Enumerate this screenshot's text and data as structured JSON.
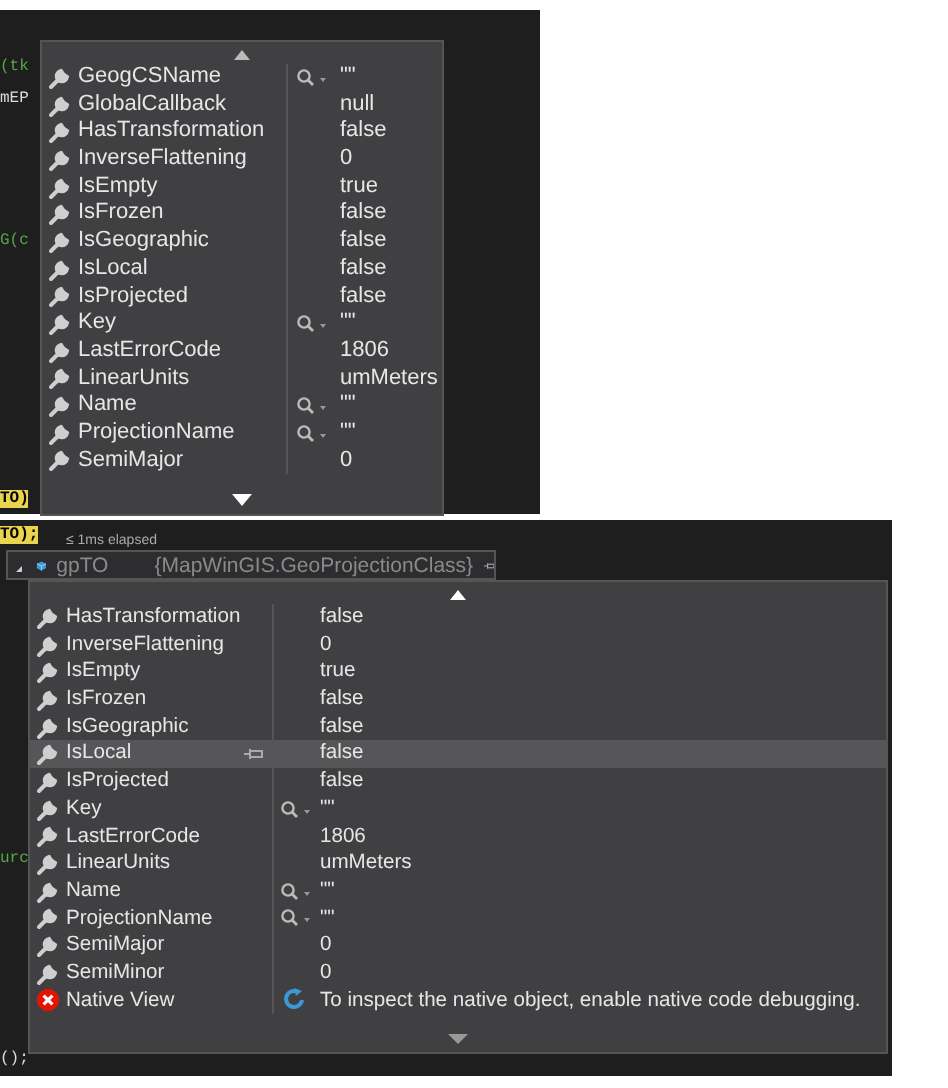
{
  "top_shot": {
    "code": [
      {
        "text": "(tk",
        "kind": "green"
      },
      {
        "text": "mEP",
        "kind": "plain"
      },
      {
        "text": "G(c",
        "kind": "green"
      },
      {
        "text": "TO)",
        "kind": "highlight"
      }
    ],
    "datatip": {
      "rows": [
        {
          "kind": "property",
          "name": "GeogCSName",
          "value": "\"\"",
          "searchable": true,
          "selected": false
        },
        {
          "kind": "property",
          "name": "GlobalCallback",
          "value": "null",
          "searchable": false,
          "selected": false
        },
        {
          "kind": "property",
          "name": "HasTransformation",
          "value": "false",
          "searchable": false,
          "selected": false
        },
        {
          "kind": "property",
          "name": "InverseFlattening",
          "value": "0",
          "searchable": false,
          "selected": false
        },
        {
          "kind": "property",
          "name": "IsEmpty",
          "value": "true",
          "searchable": false,
          "selected": false
        },
        {
          "kind": "property",
          "name": "IsFrozen",
          "value": "false",
          "searchable": false,
          "selected": false
        },
        {
          "kind": "property",
          "name": "IsGeographic",
          "value": "false",
          "searchable": false,
          "selected": false
        },
        {
          "kind": "property",
          "name": "IsLocal",
          "value": "false",
          "searchable": false,
          "selected": false
        },
        {
          "kind": "property",
          "name": "IsProjected",
          "value": "false",
          "searchable": false,
          "selected": false
        },
        {
          "kind": "property",
          "name": "Key",
          "value": "\"\"",
          "searchable": true,
          "selected": false
        },
        {
          "kind": "property",
          "name": "LastErrorCode",
          "value": "1806",
          "searchable": false,
          "selected": false
        },
        {
          "kind": "property",
          "name": "LinearUnits",
          "value": "umMeters",
          "searchable": false,
          "selected": false
        },
        {
          "kind": "property",
          "name": "Name",
          "value": "\"\"",
          "searchable": true,
          "selected": false
        },
        {
          "kind": "property",
          "name": "ProjectionName",
          "value": "\"\"",
          "searchable": true,
          "selected": false
        },
        {
          "kind": "property",
          "name": "SemiMajor",
          "value": "0",
          "searchable": false,
          "selected": false
        }
      ]
    }
  },
  "bottom_shot": {
    "code": [
      {
        "text": "TO);",
        "kind": "highlight"
      },
      {
        "text": "urc",
        "kind": "green"
      },
      {
        "text": "();",
        "kind": "plain"
      }
    ],
    "elapsed": "≤ 1ms elapsed",
    "variable": {
      "name": "gpTO",
      "type": "{MapWinGIS.GeoProjectionClass}"
    },
    "datatip": {
      "rows": [
        {
          "kind": "property",
          "name": "HasTransformation",
          "value": "false",
          "searchable": false,
          "selected": false
        },
        {
          "kind": "property",
          "name": "InverseFlattening",
          "value": "0",
          "searchable": false,
          "selected": false
        },
        {
          "kind": "property",
          "name": "IsEmpty",
          "value": "true",
          "searchable": false,
          "selected": false
        },
        {
          "kind": "property",
          "name": "IsFrozen",
          "value": "false",
          "searchable": false,
          "selected": false
        },
        {
          "kind": "property",
          "name": "IsGeographic",
          "value": "false",
          "searchable": false,
          "selected": false
        },
        {
          "kind": "property",
          "name": "IsLocal",
          "value": "false",
          "searchable": false,
          "selected": true
        },
        {
          "kind": "property",
          "name": "IsProjected",
          "value": "false",
          "searchable": false,
          "selected": false
        },
        {
          "kind": "property",
          "name": "Key",
          "value": "\"\"",
          "searchable": true,
          "selected": false
        },
        {
          "kind": "property",
          "name": "LastErrorCode",
          "value": "1806",
          "searchable": false,
          "selected": false
        },
        {
          "kind": "property",
          "name": "LinearUnits",
          "value": "umMeters",
          "searchable": false,
          "selected": false
        },
        {
          "kind": "property",
          "name": "Name",
          "value": "\"\"",
          "searchable": true,
          "selected": false
        },
        {
          "kind": "property",
          "name": "ProjectionName",
          "value": "\"\"",
          "searchable": true,
          "selected": false
        },
        {
          "kind": "property",
          "name": "SemiMajor",
          "value": "0",
          "searchable": false,
          "selected": false
        },
        {
          "kind": "property",
          "name": "SemiMinor",
          "value": "0",
          "searchable": false,
          "selected": false
        },
        {
          "kind": "native",
          "name": "Native View",
          "value": "To inspect the native object, enable native code debugging.",
          "searchable": false,
          "selected": false
        }
      ]
    }
  }
}
